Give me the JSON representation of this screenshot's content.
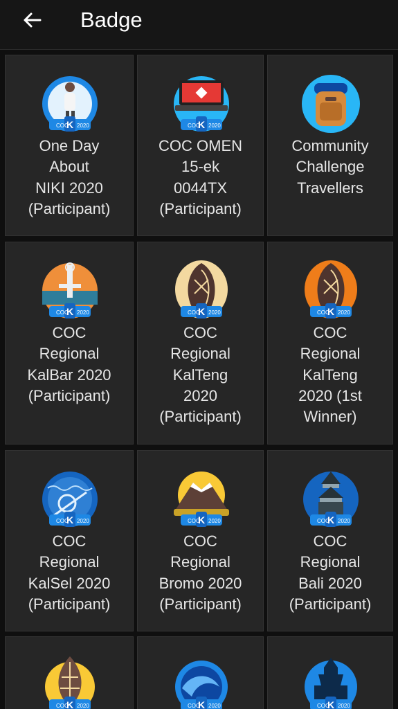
{
  "header": {
    "title": "Badge",
    "back_icon": "arrow-left-icon"
  },
  "badges": [
    {
      "label": "One Day\nAbout\nNIKI 2020\n(Participant)",
      "icon": "niki-badge-icon",
      "badge_text": "COC 2020"
    },
    {
      "label": "COC OMEN\n15-ek\n0044TX\n(Participant)",
      "icon": "laptop-badge-icon",
      "badge_text": "COC 2020"
    },
    {
      "label": "Community\nChallenge\nTravellers",
      "icon": "backpack-badge-icon",
      "badge_text": ""
    },
    {
      "label": "COC\nRegional\nKalBar 2020\n(Participant)",
      "icon": "monument-badge-icon",
      "badge_text": "COC 2020"
    },
    {
      "label": "COC\nRegional\nKalTeng\n2020\n(Participant)",
      "icon": "shield-pattern-badge-icon",
      "badge_text": "COC 2020"
    },
    {
      "label": "COC\nRegional\nKalTeng\n2020 (1st\nWinner)",
      "icon": "shield-pattern-orange-badge-icon",
      "badge_text": "COC 2020"
    },
    {
      "label": "COC\nRegional\nKalSel 2020\n(Participant)",
      "icon": "boat-badge-icon",
      "badge_text": "COC 2020"
    },
    {
      "label": "COC\nRegional\nBromo 2020\n(Participant)",
      "icon": "mountain-badge-icon",
      "badge_text": "COC 2020"
    },
    {
      "label": "COC\nRegional\nBali 2020\n(Participant)",
      "icon": "temple-badge-icon",
      "badge_text": "COC 2020"
    },
    {
      "label": "",
      "icon": "gunungan-badge-icon",
      "badge_text": "COC 2020"
    },
    {
      "label": "",
      "icon": "wave-badge-icon",
      "badge_text": "COC 2020"
    },
    {
      "label": "",
      "icon": "candi-badge-icon",
      "badge_text": "COC 2020"
    }
  ],
  "colors": {
    "background": "#0f0f0f",
    "card": "#262626",
    "text": "#e6e6e6",
    "kaskus_blue": "#1e88e5"
  }
}
